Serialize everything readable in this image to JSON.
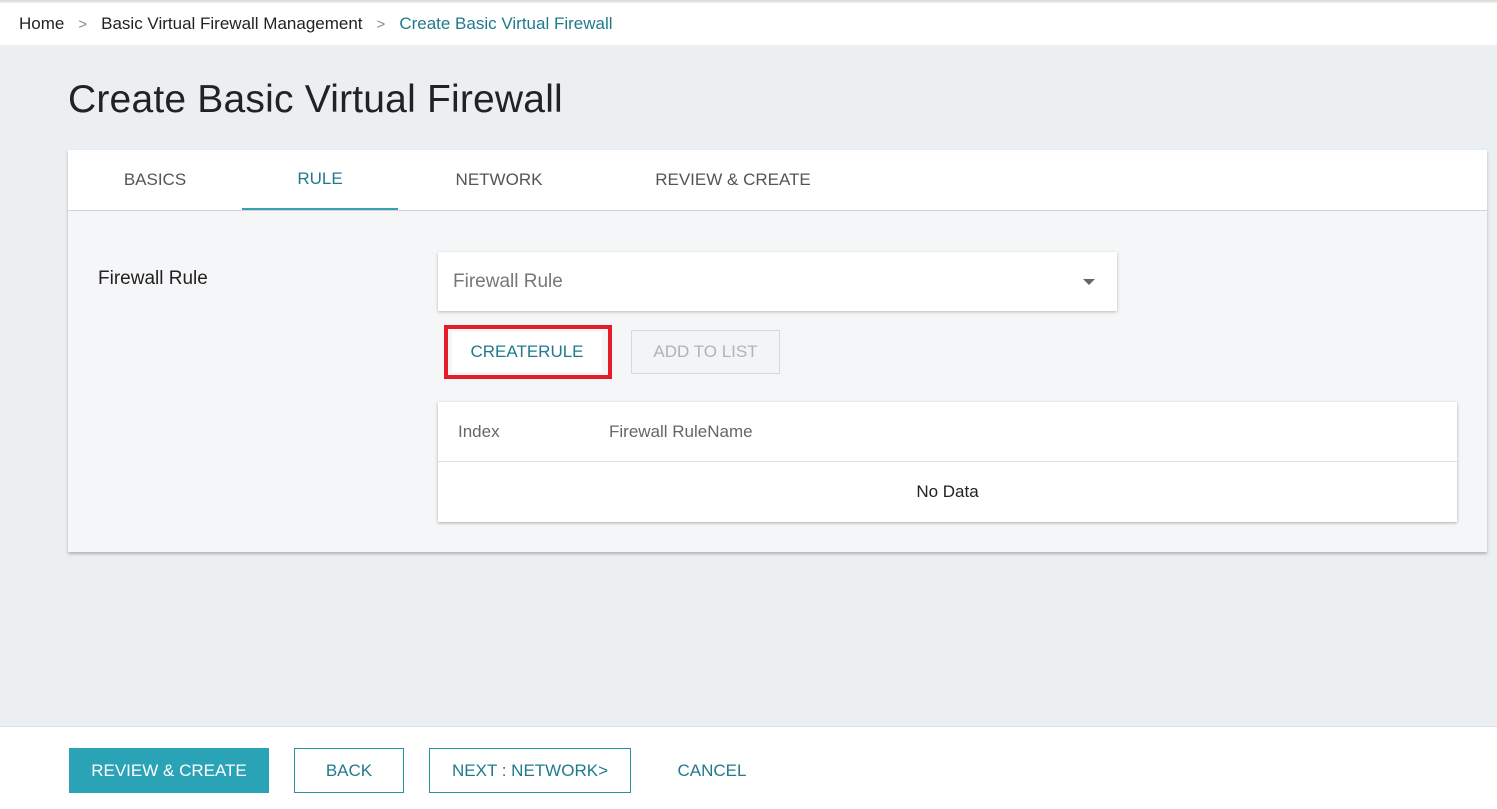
{
  "breadcrumb": {
    "items": [
      "Home",
      "Basic Virtual Firewall Management",
      "Create Basic Virtual Firewall"
    ],
    "separator": ">"
  },
  "page": {
    "title": "Create Basic Virtual Firewall"
  },
  "tabs": [
    {
      "label": "BASICS",
      "active": false
    },
    {
      "label": "RULE",
      "active": true
    },
    {
      "label": "NETWORK",
      "active": false
    },
    {
      "label": "REVIEW & CREATE",
      "active": false
    }
  ],
  "rule_form": {
    "label": "Firewall Rule",
    "select_placeholder": "Firewall Rule",
    "create_rule_label": "CREATERULE",
    "add_to_list_label": "ADD TO LIST"
  },
  "rule_table": {
    "columns": [
      "Index",
      "Firewall RuleName"
    ],
    "empty_text": "No Data"
  },
  "footer": {
    "review_create_label": "REVIEW & CREATE",
    "back_label": "BACK",
    "next_label": "NEXT : NETWORK>",
    "cancel_label": "CANCEL"
  },
  "colors": {
    "accent": "#1f7a8c",
    "primary_button": "#2aa3b7",
    "highlight": "#e41e26"
  }
}
